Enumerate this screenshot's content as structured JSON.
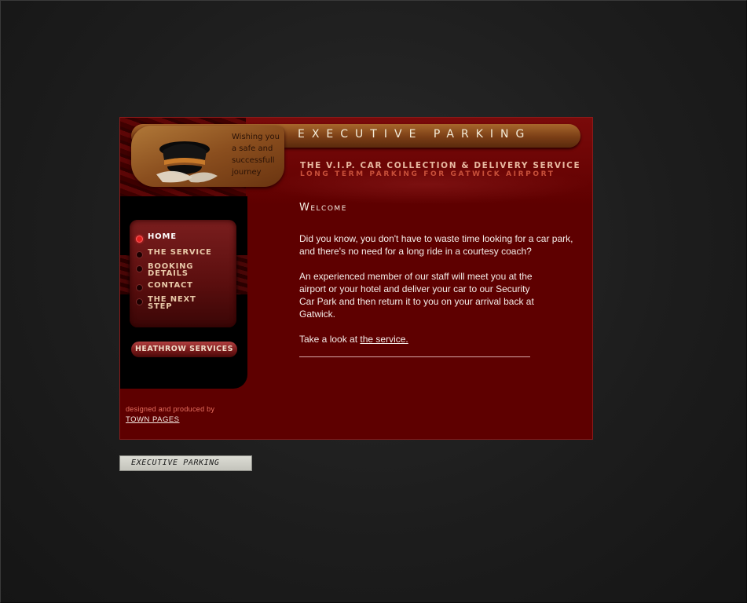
{
  "header": {
    "brand_title": "EXECUTIVE PARKING",
    "wish_line_1": "Wishing you",
    "wish_line_2": "a safe and",
    "wish_line_3": "successfull",
    "wish_line_4": "journey",
    "tagline_1": "THE V.I.P. CAR COLLECTION & DELIVERY SERVICE",
    "tagline_2": "LONG TERM PARKING FOR GATWICK AIRPORT"
  },
  "nav": {
    "items": [
      {
        "label_1": "HOME",
        "label_2": ""
      },
      {
        "label_1": "THE SERVICE",
        "label_2": ""
      },
      {
        "label_1": "BOOKING",
        "label_2": "DETAILS"
      },
      {
        "label_1": "CONTACT",
        "label_2": ""
      },
      {
        "label_1": "THE NEXT",
        "label_2": "STEP"
      }
    ],
    "heathrow_label": "HEATHROW SERVICES"
  },
  "credit": {
    "text": "designed and produced by",
    "link": "TOWN PAGES"
  },
  "main": {
    "title": "Welcome",
    "para_1": "Did you know, you don't have to waste time looking for a car park, and there's no need for a long ride in a courtesy coach?",
    "para_2": "An experienced member of our staff will meet you at the airport or your hotel and deliver your car to our Security Car Park and then return it to you on your arrival back at Gatwick.",
    "para_3_prefix": "Take a look at ",
    "para_3_link": "the service."
  },
  "footer": {
    "logo_text": "EXECUTIVE PARKING"
  },
  "colors": {
    "panel": "#5e0000",
    "accent": "#e02020",
    "bronze": "#a8672c"
  },
  "icons": [
    "chauffeur-cap-icon"
  ]
}
